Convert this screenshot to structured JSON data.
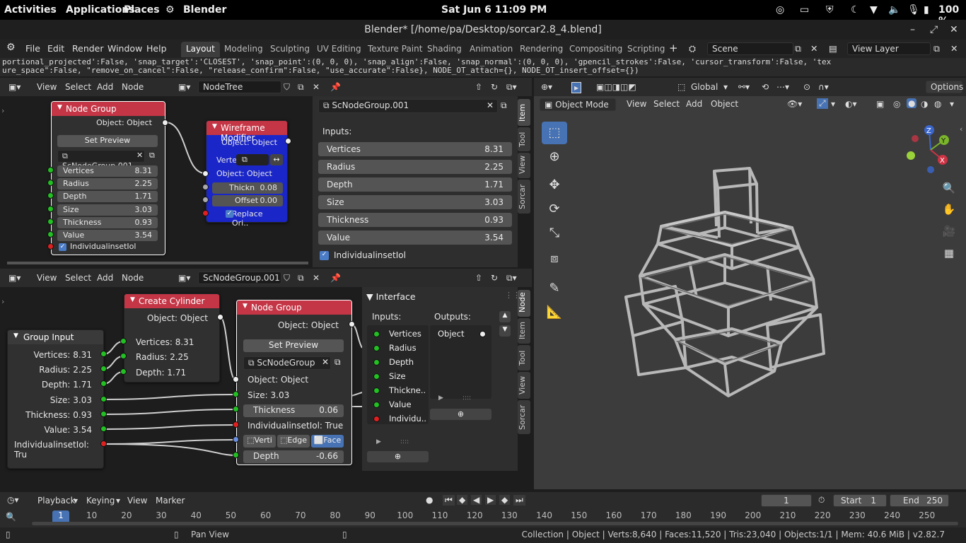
{
  "gnome": {
    "activities": "Activities",
    "applications": "Applications",
    "places": "Places",
    "app_name": "Blender",
    "clock": "Sat Jun 6  11:09 PM",
    "battery": "100 %"
  },
  "window_title": "Blender* [/home/pa/Desktop/sorcar2.8_4.blend]",
  "menu": [
    "File",
    "Edit",
    "Render",
    "Window",
    "Help"
  ],
  "workspace_tabs": [
    "Layout",
    "Modeling",
    "Sculpting",
    "UV Editing",
    "Texture Paint",
    "Shading",
    "Animation",
    "Rendering",
    "Compositing",
    "Scripting"
  ],
  "active_tab": "Layout",
  "scene": "Scene",
  "view_layer": "View Layer",
  "console_lines": [
    "portional_projected':False, 'snap_target':'CLOSEST', 'snap_point':(0, 0, 0), 'snap_align':False, 'snap_normal':(0, 0, 0), 'gpencil_strokes':False, 'cursor_transform':False, 'tex",
    "ure_space\":False, \"remove_on_cancel\":False, \"release_confirm\":False, \"use_accurate\":False}, NODE_OT_attach={}, NODE_OT_insert_offset={})"
  ],
  "top_node_editor": {
    "menus": [
      "View",
      "Select",
      "Add",
      "Node"
    ],
    "tree_name": "NodeTree",
    "node_group": {
      "title": "Node Group",
      "output": "Object: Object",
      "set_preview": "Set Preview",
      "group_name": "ScNodeGroup.001",
      "inputs": [
        {
          "label": "Vertices",
          "value": "8.31"
        },
        {
          "label": "Radius",
          "value": "2.25"
        },
        {
          "label": "Depth",
          "value": "1.71"
        },
        {
          "label": "Size",
          "value": "3.03"
        },
        {
          "label": "Thickness",
          "value": "0.93"
        },
        {
          "label": "Value",
          "value": "3.54"
        }
      ],
      "checkbox": "IndividualinsetIol"
    },
    "wireframe": {
      "title": "Wireframe Modifier",
      "output": "Object: Object",
      "verte_label": "Verte",
      "input": "Object: Object",
      "thick_label": "Thickn",
      "thick_value": "0.08",
      "offset_label": "Offset",
      "offset_value": "0.00",
      "replace": "Replace Ori.."
    }
  },
  "item_panel": {
    "group_name": "ScNodeGroup.001",
    "inputs_label": "Inputs:",
    "fields": [
      {
        "label": "Vertices",
        "value": "8.31"
      },
      {
        "label": "Radius",
        "value": "2.25"
      },
      {
        "label": "Depth",
        "value": "1.71"
      },
      {
        "label": "Size",
        "value": "3.03"
      },
      {
        "label": "Thickness",
        "value": "0.93"
      },
      {
        "label": "Value",
        "value": "3.54"
      }
    ],
    "checkbox": "IndividualinsetIol",
    "tabs": [
      "Item",
      "Tool",
      "View",
      "Sorcar"
    ]
  },
  "bottom_node_editor": {
    "menus": [
      "View",
      "Select",
      "Add",
      "Node"
    ],
    "tree_name": "ScNodeGroup.001",
    "group_input": {
      "title": "Group Input",
      "rows": [
        "Vertices: 8.31",
        "Radius: 2.25",
        "Depth: 1.71",
        "Size: 3.03",
        "Thickness: 0.93",
        "Value: 3.54",
        "IndividualinsetIol: Tru"
      ]
    },
    "create_cylinder": {
      "title": "Create Cylinder",
      "output": "Object: Object",
      "rows": [
        "Vertices: 8.31",
        "Radius: 2.25",
        "Depth: 1.71"
      ]
    },
    "node_group": {
      "title": "Node Group",
      "output": "Object: Object",
      "set_preview": "Set Preview",
      "group_name": "ScNodeGroup",
      "input": "Object: Object",
      "size": "Size: 3.03",
      "thickness_label": "Thickness",
      "thickness_value": "0.06",
      "individual": "IndividualinsetIol: True",
      "mode_verti": "Verti",
      "mode_edge": "Edge",
      "mode_face": "Face",
      "depth_label": "Depth",
      "depth_value": "-0.66"
    },
    "interface": {
      "title": "Interface",
      "inputs_label": "Inputs:",
      "outputs_label": "Outputs:",
      "inputs": [
        "Vertices",
        "Radius",
        "Depth",
        "Size",
        "Thickne..",
        "Value",
        "Individu.."
      ],
      "outputs": [
        "Object"
      ]
    },
    "tabs": [
      "Node",
      "Item",
      "Tool",
      "View",
      "Sorcar"
    ]
  },
  "viewport": {
    "transform": "Global",
    "options": "Options",
    "mode": "Object Mode",
    "menus": [
      "View",
      "Select",
      "Add",
      "Object"
    ],
    "gizmo_axes": [
      "Z",
      "Y",
      "X"
    ]
  },
  "timeline": {
    "menus": [
      "Playback",
      "Keying",
      "View",
      "Marker"
    ],
    "current_frame": "1",
    "start_label": "Start",
    "start": "1",
    "end_label": "End",
    "end": "250",
    "frame_marker": "1",
    "ticks": [
      "10",
      "20",
      "30",
      "40",
      "50",
      "60",
      "70",
      "80",
      "90",
      "100",
      "110",
      "120",
      "130",
      "140",
      "150",
      "160",
      "170",
      "180",
      "190",
      "200",
      "210",
      "220",
      "230",
      "240",
      "250"
    ]
  },
  "status": {
    "hint": "Pan View",
    "stats": "Collection | Object | Verts:8,640 | Faces:11,520 | Tris:23,040 | Objects:1/1 | Mem: 40.6 MiB | v2.82.7"
  },
  "colors": {
    "node_group_header": "#c43545",
    "wireframe_header": "#c43545",
    "wireframe_body": "#1a26c8",
    "active_blue": "#4772b3",
    "socket_green": "#22c022",
    "socket_red": "#e02020"
  }
}
